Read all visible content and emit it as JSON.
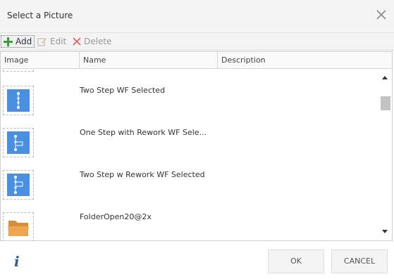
{
  "dialog": {
    "title": "Select a Picture"
  },
  "toolbar": {
    "add_label": "Add",
    "edit_label": "Edit",
    "delete_label": "Delete"
  },
  "grid": {
    "columns": [
      "Image",
      "Name",
      "Description"
    ],
    "rows": [
      {
        "name": "Two Step WF Selected",
        "description": "",
        "icon": "two-step-workflow-icon"
      },
      {
        "name": "One Step with Rework WF Sele...",
        "description": "",
        "icon": "one-step-rework-workflow-icon"
      },
      {
        "name": "Two Step w Rework WF Selected",
        "description": "",
        "icon": "two-step-rework-workflow-icon"
      },
      {
        "name": "FolderOpen20@2x",
        "description": "",
        "icon": "folder-open-icon"
      }
    ]
  },
  "footer": {
    "info_symbol": "i",
    "ok_label": "OK",
    "cancel_label": "CANCEL"
  },
  "colors": {
    "workflow_blue": "#4a90e2",
    "folder_orange": "#f0a650",
    "add_green": "#3aa13a",
    "delete_red": "#e06060"
  }
}
